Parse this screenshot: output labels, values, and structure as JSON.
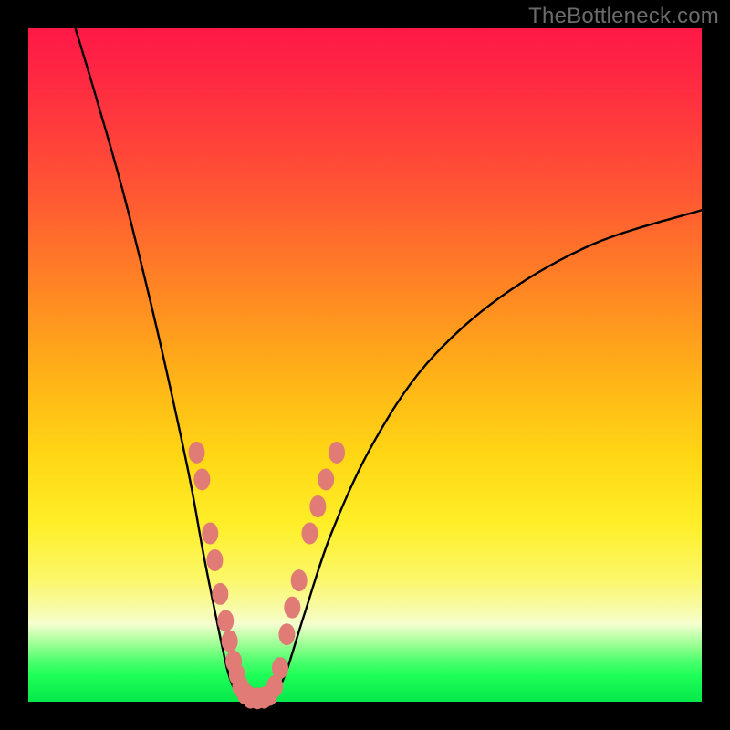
{
  "watermark": "TheBottleneck.com",
  "chart_data": {
    "type": "line",
    "title": "",
    "xlabel": "",
    "ylabel": "",
    "xlim": [
      0,
      100
    ],
    "ylim": [
      0,
      100
    ],
    "note": "Two curves descending into a V-shaped minimum in the green band. Left curve originates at top-left, right curve is shallower and ends mid-right edge. Salmon oval markers decorate both arms near the trough.",
    "series": [
      {
        "name": "left-curve",
        "x": [
          7,
          10,
          14,
          18,
          21,
          24,
          26,
          28,
          29.5,
          30.5,
          31.3,
          32
        ],
        "y": [
          100,
          90,
          76,
          60,
          47,
          33,
          22,
          12,
          5,
          2,
          0.8,
          0.2
        ]
      },
      {
        "name": "right-curve",
        "x": [
          36,
          37,
          38.5,
          41,
          45,
          51,
          59,
          70,
          84,
          100
        ],
        "y": [
          0.2,
          1.5,
          5,
          13,
          25,
          38,
          50,
          60,
          68,
          73
        ]
      },
      {
        "name": "trough-flat",
        "x": [
          32,
          33,
          34,
          35,
          36
        ],
        "y": [
          0.2,
          0,
          0,
          0,
          0.2
        ]
      }
    ],
    "markers": {
      "name": "salmon-ovals",
      "color": "#e17b76",
      "points": [
        {
          "x": 25.0,
          "y": 37
        },
        {
          "x": 25.8,
          "y": 33
        },
        {
          "x": 27.0,
          "y": 25
        },
        {
          "x": 27.7,
          "y": 21
        },
        {
          "x": 28.5,
          "y": 16
        },
        {
          "x": 29.3,
          "y": 12
        },
        {
          "x": 29.9,
          "y": 9
        },
        {
          "x": 30.5,
          "y": 6
        },
        {
          "x": 31.0,
          "y": 4
        },
        {
          "x": 31.5,
          "y": 2.3
        },
        {
          "x": 32.2,
          "y": 1.2
        },
        {
          "x": 33.0,
          "y": 0.6
        },
        {
          "x": 34.0,
          "y": 0.5
        },
        {
          "x": 35.0,
          "y": 0.6
        },
        {
          "x": 35.8,
          "y": 1.0
        },
        {
          "x": 36.6,
          "y": 2.3
        },
        {
          "x": 37.4,
          "y": 5
        },
        {
          "x": 38.4,
          "y": 10
        },
        {
          "x": 39.2,
          "y": 14
        },
        {
          "x": 40.2,
          "y": 18
        },
        {
          "x": 41.8,
          "y": 25
        },
        {
          "x": 43.0,
          "y": 29
        },
        {
          "x": 44.2,
          "y": 33
        },
        {
          "x": 45.8,
          "y": 37
        }
      ]
    }
  }
}
